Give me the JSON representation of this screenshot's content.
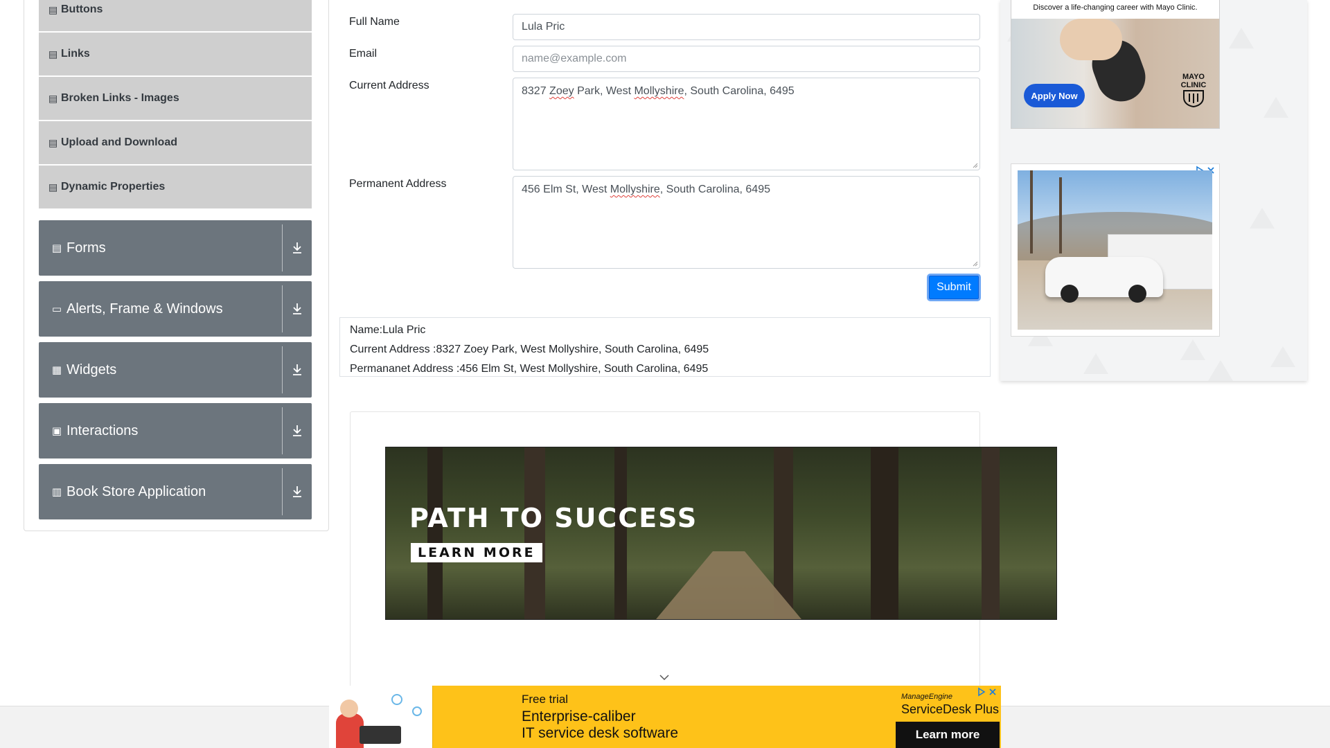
{
  "sidebar": {
    "sub_items": [
      {
        "label": "Buttons"
      },
      {
        "label": "Links"
      },
      {
        "label": "Broken Links - Images"
      },
      {
        "label": "Upload and Download"
      },
      {
        "label": "Dynamic Properties"
      }
    ],
    "groups": [
      {
        "label": "Forms",
        "icon": "document-icon"
      },
      {
        "label": "Alerts, Frame & Windows",
        "icon": "window-icon"
      },
      {
        "label": "Widgets",
        "icon": "widgets-icon"
      },
      {
        "label": "Interactions",
        "icon": "interactions-icon"
      },
      {
        "label": "Book Store Application",
        "icon": "books-icon"
      }
    ]
  },
  "form": {
    "full_name": {
      "label": "Full Name",
      "value": "Lula Pric"
    },
    "email": {
      "label": "Email",
      "placeholder": "name@example.com"
    },
    "current_address": {
      "label": "Current Address",
      "value_pre": "8327 ",
      "value_w1": "Zoey",
      "value_mid": " Park, West ",
      "value_w2": "Mollyshire",
      "value_post": ", South Carolina, 6495"
    },
    "permanent_address": {
      "label": "Permanent Address",
      "value_pre": "456 Elm St, West ",
      "value_w1": "Mollyshire",
      "value_post": ", South Carolina, 6495"
    },
    "submit_label": "Submit"
  },
  "output": {
    "name": "Name:Lula Pric",
    "current_address": "Current Address :8327 Zoey Park, West Mollyshire, South Carolina, 6495",
    "permanent_address": "Permananet Address :456 Elm St, West Mollyshire, South Carolina, 6495"
  },
  "ads": {
    "mayo": {
      "tagline": "Discover a life-changing career with Mayo Clinic.",
      "cta": "Apply Now",
      "brand_line1": "MAYO",
      "brand_line2": "CLINIC"
    },
    "banner": {
      "headline": "PATH TO SUCCESS",
      "cta": "LEARN MORE"
    },
    "bottom": {
      "line1": "Free trial",
      "line2": "Enterprise-caliber",
      "line3": "IT service desk software",
      "brand1": "ManageEngine",
      "brand2": "ServiceDesk Plus",
      "cta": "Learn more"
    }
  },
  "colors": {
    "primary": "#007bff",
    "sidebar_group": "#6c757d",
    "sidebar_item": "#cfcfcf",
    "ad_yellow": "#fec219"
  }
}
